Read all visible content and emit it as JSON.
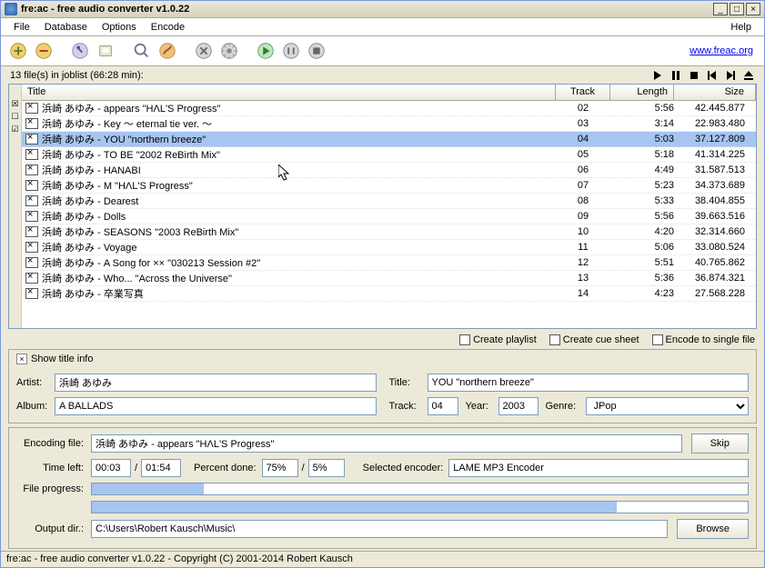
{
  "title": "fre:ac - free audio converter v1.0.22",
  "menu": {
    "file": "File",
    "database": "Database",
    "options": "Options",
    "encode": "Encode",
    "help": "Help"
  },
  "link": "www.freac.org",
  "joblist_header": "13 file(s) in joblist (66:28 min):",
  "cols": {
    "title": "Title",
    "track": "Track",
    "length": "Length",
    "size": "Size"
  },
  "rows": [
    {
      "title": "浜崎 あゆみ - appears \"HΛL'S Progress\"",
      "track": "02",
      "length": "5:56",
      "size": "42.445.877",
      "sel": false
    },
    {
      "title": "浜崎 あゆみ - Key ～ eternal tie ver. ～",
      "track": "03",
      "length": "3:14",
      "size": "22.983.480",
      "sel": false
    },
    {
      "title": "浜崎 あゆみ - YOU \"northern breeze\"",
      "track": "04",
      "length": "5:03",
      "size": "37.127.809",
      "sel": true
    },
    {
      "title": "浜崎 あゆみ - TO BE \"2002 ReBirth Mix\"",
      "track": "05",
      "length": "5:18",
      "size": "41.314.225",
      "sel": false
    },
    {
      "title": "浜崎 あゆみ - HANABI",
      "track": "06",
      "length": "4:49",
      "size": "31.587.513",
      "sel": false
    },
    {
      "title": "浜崎 あゆみ - M \"HΛL'S Progress\"",
      "track": "07",
      "length": "5:23",
      "size": "34.373.689",
      "sel": false
    },
    {
      "title": "浜崎 あゆみ - Dearest",
      "track": "08",
      "length": "5:33",
      "size": "38.404.855",
      "sel": false
    },
    {
      "title": "浜崎 あゆみ - Dolls",
      "track": "09",
      "length": "5:56",
      "size": "39.663.516",
      "sel": false
    },
    {
      "title": "浜崎 あゆみ - SEASONS \"2003 ReBirth Mix\"",
      "track": "10",
      "length": "4:20",
      "size": "32.314.660",
      "sel": false
    },
    {
      "title": "浜崎 あゆみ - Voyage",
      "track": "11",
      "length": "5:06",
      "size": "33.080.524",
      "sel": false
    },
    {
      "title": "浜崎 あゆみ - A Song for ×× \"030213 Session #2\"",
      "track": "12",
      "length": "5:51",
      "size": "40.765.862",
      "sel": false
    },
    {
      "title": "浜崎 あゆみ - Who... \"Across the Universe\"",
      "track": "13",
      "length": "5:36",
      "size": "36.874.321",
      "sel": false
    },
    {
      "title": "浜崎 あゆみ - 卒業写真",
      "track": "14",
      "length": "4:23",
      "size": "27.568.228",
      "sel": false
    }
  ],
  "opts": {
    "playlist": "Create playlist",
    "cue": "Create cue sheet",
    "single": "Encode to single file"
  },
  "titleinfo": {
    "header": "Show title info",
    "artist_l": "Artist:",
    "artist_v": "浜崎 あゆみ",
    "album_l": "Album:",
    "album_v": "A BALLADS",
    "title_l": "Title:",
    "title_v": "YOU \"northern breeze\"",
    "track_l": "Track:",
    "track_v": "04",
    "year_l": "Year:",
    "year_v": "2003",
    "genre_l": "Genre:",
    "genre_v": "JPop"
  },
  "prog": {
    "encfile_l": "Encoding file:",
    "encfile_v": "浜崎 あゆみ - appears \"HΛL'S Progress\"",
    "skip": "Skip",
    "time_l": "Time left:",
    "t1": "00:03",
    "t2": "01:54",
    "pct_l": "Percent done:",
    "p1": "75%",
    "p2": "5%",
    "enc_l": "Selected encoder:",
    "enc_v": "LAME MP3 Encoder",
    "fprog": "File progress:",
    "out_l": "Output dir.:",
    "out_v": "C:\\Users\\Robert Kausch\\Music\\",
    "browse": "Browse"
  },
  "status": "fre:ac - free audio converter v1.0.22 - Copyright (C) 2001-2014 Robert Kausch"
}
